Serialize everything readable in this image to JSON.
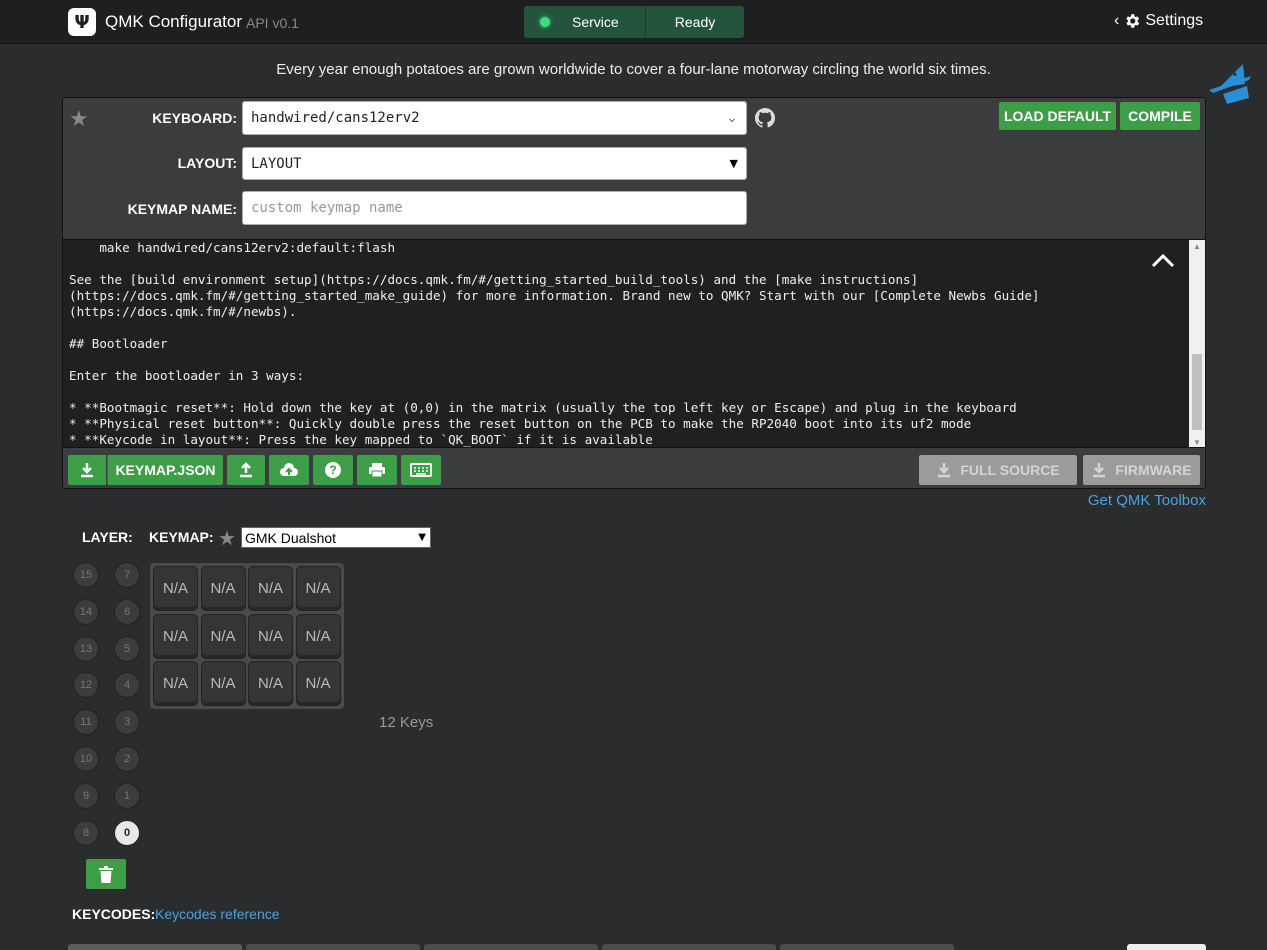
{
  "header": {
    "logo_glyph": "Ψ",
    "title": "QMK Configurator",
    "api_version": "API v0.1",
    "service_label": "Service",
    "status_label": "Ready",
    "settings_label": "Settings"
  },
  "tagline": "Every year enough potatoes are grown worldwide to cover a four-lane motorway circling the world six times.",
  "form": {
    "keyboard_label": "KEYBOARD:",
    "keyboard_value": "handwired/cans12erv2",
    "layout_label": "LAYOUT:",
    "layout_value": "LAYOUT",
    "keymap_name_label": "KEYMAP NAME:",
    "keymap_name_placeholder": "custom keymap name",
    "load_default_label": "LOAD DEFAULT",
    "compile_label": "COMPILE"
  },
  "readme": {
    "lines": [
      "    make handwired/cans12erv2:default:flash",
      "",
      "See the [build environment setup](https://docs.qmk.fm/#/getting_started_build_tools) and the [make instructions]",
      "(https://docs.qmk.fm/#/getting_started_make_guide) for more information. Brand new to QMK? Start with our [Complete Newbs Guide]",
      "(https://docs.qmk.fm/#/newbs).",
      "",
      "## Bootloader",
      "",
      "Enter the bootloader in 3 ways:",
      "",
      "* **Bootmagic reset**: Hold down the key at (0,0) in the matrix (usually the top left key or Escape) and plug in the keyboard",
      "* **Physical reset button**: Quickly double press the reset button on the PCB to make the RP2040 boot into its uf2 mode",
      "* **Keycode in layout**: Press the key mapped to `QK_BOOT` if it is available"
    ]
  },
  "toolbar": {
    "keymap_json_label": "KEYMAP.JSON",
    "full_source_label": "FULL SOURCE",
    "firmware_label": "FIRMWARE"
  },
  "toolbox_link": "Get QMK Toolbox",
  "layers": {
    "label": "LAYER:",
    "active": "0",
    "left_column": [
      "15",
      "14",
      "13",
      "12",
      "11",
      "10",
      "9",
      "8"
    ],
    "right_column": [
      "7",
      "6",
      "5",
      "4",
      "3",
      "2",
      "1",
      "0"
    ]
  },
  "keymap": {
    "label": "KEYMAP:",
    "selected": "GMK Dualshot"
  },
  "keyboard": {
    "keys": [
      "N/A",
      "N/A",
      "N/A",
      "N/A",
      "N/A",
      "N/A",
      "N/A",
      "N/A",
      "N/A",
      "N/A",
      "N/A",
      "N/A"
    ],
    "key_count": "12 Keys"
  },
  "keycodes": {
    "label": "KEYCODES:",
    "link": "Keycodes reference"
  },
  "colors": {
    "accent_green": "#3d9e47",
    "link_blue": "#4aa3df",
    "background": "#2a2c2e"
  }
}
